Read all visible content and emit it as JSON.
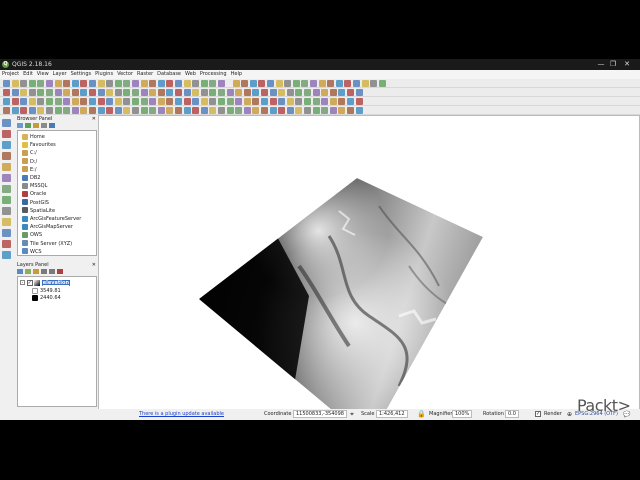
{
  "window": {
    "title": "QGIS 2.18.16",
    "controls": [
      "—",
      "❐",
      "✕"
    ]
  },
  "menu": [
    "Project",
    "Edit",
    "View",
    "Layer",
    "Settings",
    "Plugins",
    "Vector",
    "Raster",
    "Database",
    "Web",
    "Processing",
    "Help"
  ],
  "browser": {
    "title": "Browser Panel",
    "items": [
      {
        "label": "Home",
        "icon": "folder-icon",
        "color": "#d8b25a",
        "indent": 0
      },
      {
        "label": "Favourites",
        "icon": "star-icon",
        "color": "#e0c040",
        "indent": 0
      },
      {
        "label": "C:/",
        "icon": "drive-icon",
        "color": "#c8a050",
        "indent": 0
      },
      {
        "label": "D:/",
        "icon": "drive-icon",
        "color": "#c8a050",
        "indent": 0
      },
      {
        "label": "E:/",
        "icon": "drive-icon",
        "color": "#c8a050",
        "indent": 0
      },
      {
        "label": "DB2",
        "icon": "database-icon",
        "color": "#4a7ab8",
        "indent": 0
      },
      {
        "label": "MSSQL",
        "icon": "database-icon",
        "color": "#8a8a8a",
        "indent": 0
      },
      {
        "label": "Oracle",
        "icon": "database-icon",
        "color": "#b04040",
        "indent": 0
      },
      {
        "label": "PostGIS",
        "icon": "elephant-icon",
        "color": "#3a6aa0",
        "indent": 0
      },
      {
        "label": "SpatiaLite",
        "icon": "feather-icon",
        "color": "#5a5a5a",
        "indent": 0
      },
      {
        "label": "ArcGisFeatureServer",
        "icon": "globe-icon",
        "color": "#3a8ac0",
        "indent": 0
      },
      {
        "label": "ArcGisMapServer",
        "icon": "globe-icon",
        "color": "#3a8ac0",
        "indent": 0
      },
      {
        "label": "OWS",
        "icon": "globe-icon",
        "color": "#6a9a6a",
        "indent": 0
      },
      {
        "label": "Tile Server (XYZ)",
        "icon": "grid-icon",
        "color": "#6a8ab0",
        "indent": 0
      },
      {
        "label": "WCS",
        "icon": "globe-icon",
        "color": "#5a8ac0",
        "indent": 0
      }
    ]
  },
  "layers": {
    "title": "Layers Panel",
    "layer": {
      "name": "elevation",
      "checked": true
    },
    "legend": [
      {
        "value": "3549.81",
        "color": "#ffffff"
      },
      {
        "value": "2440.64",
        "color": "#000000"
      }
    ]
  },
  "status": {
    "plugin_message": "There is a plugin update available",
    "coordinate_label": "Coordinate",
    "coordinate": "11500833,-354098",
    "scale_label": "Scale",
    "scale": "1:426,412",
    "magnifier_label": "Magnifier",
    "magnifier": "100%",
    "rotation_label": "Rotation",
    "rotation": "0.0",
    "render_label": "Render",
    "crs": "EPSG:2964 (OTF)"
  },
  "watermark": "Packt>",
  "colors": {
    "accent": "#2a5db0",
    "link": "#1a3fcc",
    "crs": "#2a4a9a"
  }
}
